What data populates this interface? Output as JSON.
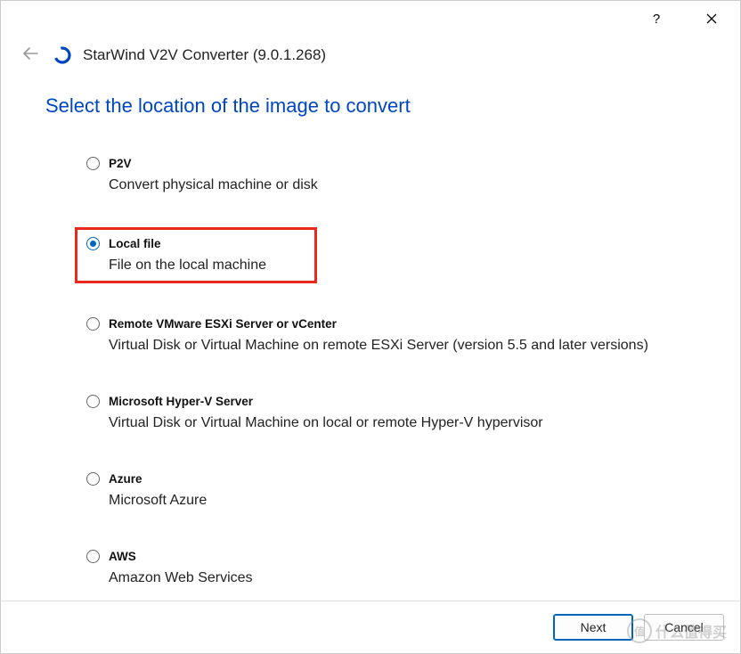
{
  "header": {
    "app_title": "StarWind V2V Converter (9.0.1.268)"
  },
  "page": {
    "heading": "Select the location of the image to convert"
  },
  "options": [
    {
      "id": "p2v",
      "label": "P2V",
      "desc": "Convert physical machine or disk",
      "selected": false
    },
    {
      "id": "local-file",
      "label": "Local file",
      "desc": "File on the local machine",
      "selected": true
    },
    {
      "id": "remote-esxi",
      "label": "Remote VMware ESXi Server or vCenter",
      "desc": "Virtual Disk or Virtual Machine on remote ESXi Server (version 5.5 and later versions)",
      "selected": false
    },
    {
      "id": "hyperv",
      "label": "Microsoft Hyper-V Server",
      "desc": "Virtual Disk or Virtual Machine on local or remote Hyper-V hypervisor",
      "selected": false
    },
    {
      "id": "azure",
      "label": "Azure",
      "desc": "Microsoft Azure",
      "selected": false
    },
    {
      "id": "aws",
      "label": "AWS",
      "desc": "Amazon Web Services",
      "selected": false
    }
  ],
  "footer": {
    "next_label": "Next",
    "cancel_label": "Cancel"
  },
  "watermark": {
    "text": "什么值得买",
    "badge": "值"
  }
}
